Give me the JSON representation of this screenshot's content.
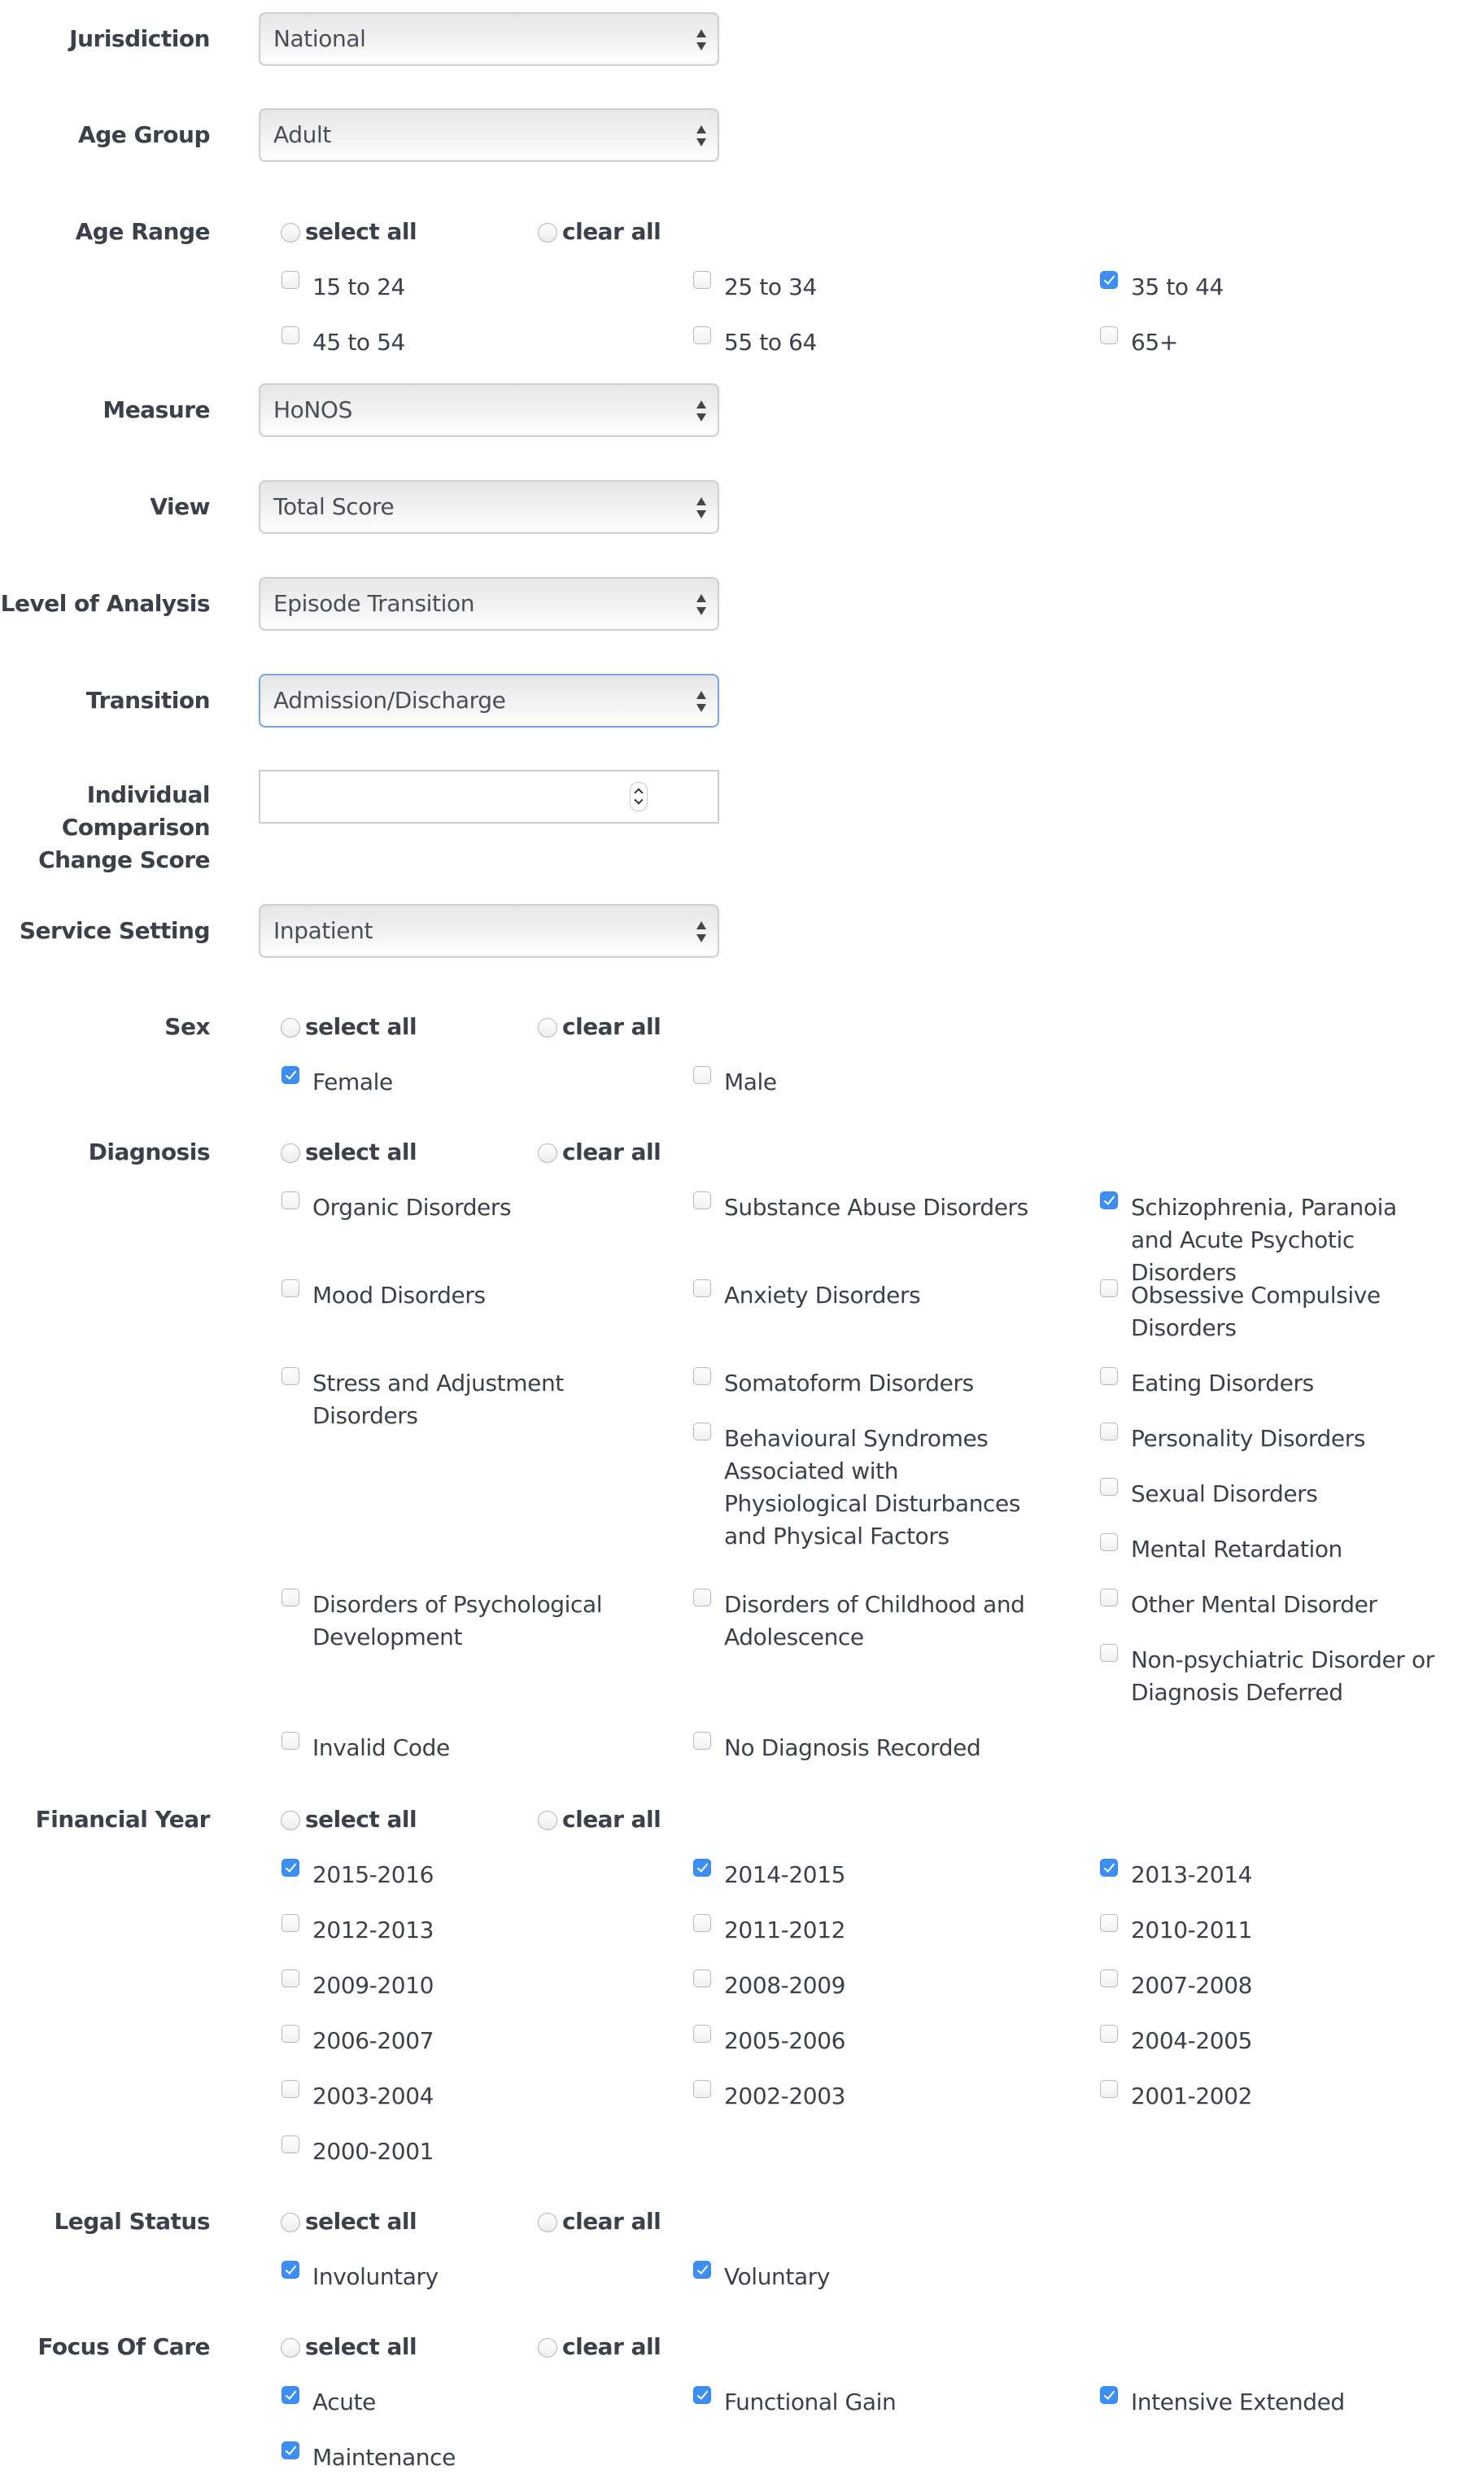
{
  "fields": {
    "jurisdiction": {
      "label": "Jurisdiction",
      "value": "National"
    },
    "age_group": {
      "label": "Age Group",
      "value": "Adult"
    },
    "age_range": {
      "label": "Age Range",
      "select_all": "select all",
      "clear_all": "clear all",
      "options": [
        {
          "label": "15 to 24",
          "checked": false
        },
        {
          "label": "25 to 34",
          "checked": false
        },
        {
          "label": "35 to 44",
          "checked": true
        },
        {
          "label": "45 to 54",
          "checked": false
        },
        {
          "label": "55 to 64",
          "checked": false
        },
        {
          "label": "65+",
          "checked": false
        }
      ]
    },
    "measure": {
      "label": "Measure",
      "value": "HoNOS"
    },
    "view": {
      "label": "View",
      "value": "Total Score"
    },
    "level_of_analysis": {
      "label": "Level of Analysis",
      "value": "Episode Transition"
    },
    "transition": {
      "label": "Transition",
      "value": "Admission/Discharge"
    },
    "individual_comparison": {
      "label_lines": [
        "Individual",
        "Comparison",
        "Change Score"
      ],
      "value": ""
    },
    "service_setting": {
      "label": "Service Setting",
      "value": "Inpatient"
    },
    "sex": {
      "label": "Sex",
      "select_all": "select all",
      "clear_all": "clear all",
      "options": [
        {
          "label": "Female",
          "checked": true
        },
        {
          "label": "Male",
          "checked": false
        }
      ]
    },
    "diagnosis": {
      "label": "Diagnosis",
      "select_all": "select all",
      "clear_all": "clear all",
      "options": [
        {
          "label": "Organic Disorders",
          "checked": false
        },
        {
          "label": "Substance Abuse Disorders",
          "checked": false
        },
        {
          "label": "Schizophrenia, Paranoia and Acute Psychotic Disorders",
          "checked": true
        },
        {
          "label": "Mood Disorders",
          "checked": false
        },
        {
          "label": "Anxiety Disorders",
          "checked": false
        },
        {
          "label": "Obsessive Compulsive Disorders",
          "checked": false
        },
        {
          "label": "Stress and Adjustment Disorders",
          "checked": false
        },
        {
          "label": "Somatoform Disorders",
          "checked": false
        },
        {
          "label": "Eating Disorders",
          "checked": false
        },
        {
          "label": "Behavioural Syndromes Associated with Physiological Disturbances and Physical Factors",
          "checked": false
        },
        {
          "label": "Personality Disorders",
          "checked": false
        },
        {
          "label": "Sexual Disorders",
          "checked": false
        },
        {
          "label": "Mental Retardation",
          "checked": false
        },
        {
          "label": "Disorders of Psychological Development",
          "checked": false
        },
        {
          "label": "Disorders of Childhood and Adolescence",
          "checked": false
        },
        {
          "label": "Other Mental Disorder",
          "checked": false
        },
        {
          "label": "Non-psychiatric Disorder or Diagnosis Deferred",
          "checked": false
        },
        {
          "label": "Invalid Code",
          "checked": false
        },
        {
          "label": "No Diagnosis Recorded",
          "checked": false
        }
      ]
    },
    "financial_year": {
      "label": "Financial Year",
      "select_all": "select all",
      "clear_all": "clear all",
      "options": [
        {
          "label": "2015-2016",
          "checked": true
        },
        {
          "label": "2014-2015",
          "checked": true
        },
        {
          "label": "2013-2014",
          "checked": true
        },
        {
          "label": "2012-2013",
          "checked": false
        },
        {
          "label": "2011-2012",
          "checked": false
        },
        {
          "label": "2010-2011",
          "checked": false
        },
        {
          "label": "2009-2010",
          "checked": false
        },
        {
          "label": "2008-2009",
          "checked": false
        },
        {
          "label": "2007-2008",
          "checked": false
        },
        {
          "label": "2006-2007",
          "checked": false
        },
        {
          "label": "2005-2006",
          "checked": false
        },
        {
          "label": "2004-2005",
          "checked": false
        },
        {
          "label": "2003-2004",
          "checked": false
        },
        {
          "label": "2002-2003",
          "checked": false
        },
        {
          "label": "2001-2002",
          "checked": false
        },
        {
          "label": "2000-2001",
          "checked": false
        }
      ]
    },
    "legal_status": {
      "label": "Legal Status",
      "select_all": "select all",
      "clear_all": "clear all",
      "options": [
        {
          "label": "Involuntary",
          "checked": true
        },
        {
          "label": "Voluntary",
          "checked": true
        }
      ]
    },
    "focus_of_care": {
      "label": "Focus Of Care",
      "select_all": "select all",
      "clear_all": "clear all",
      "options": [
        {
          "label": "Acute",
          "checked": true
        },
        {
          "label": "Functional Gain",
          "checked": true
        },
        {
          "label": "Intensive Extended",
          "checked": true
        },
        {
          "label": "Maintenance",
          "checked": true
        }
      ]
    }
  },
  "colors": {
    "checkbox_checked": "#3d8ef2",
    "focus_border": "#73a9df",
    "text": "#3b404b"
  }
}
